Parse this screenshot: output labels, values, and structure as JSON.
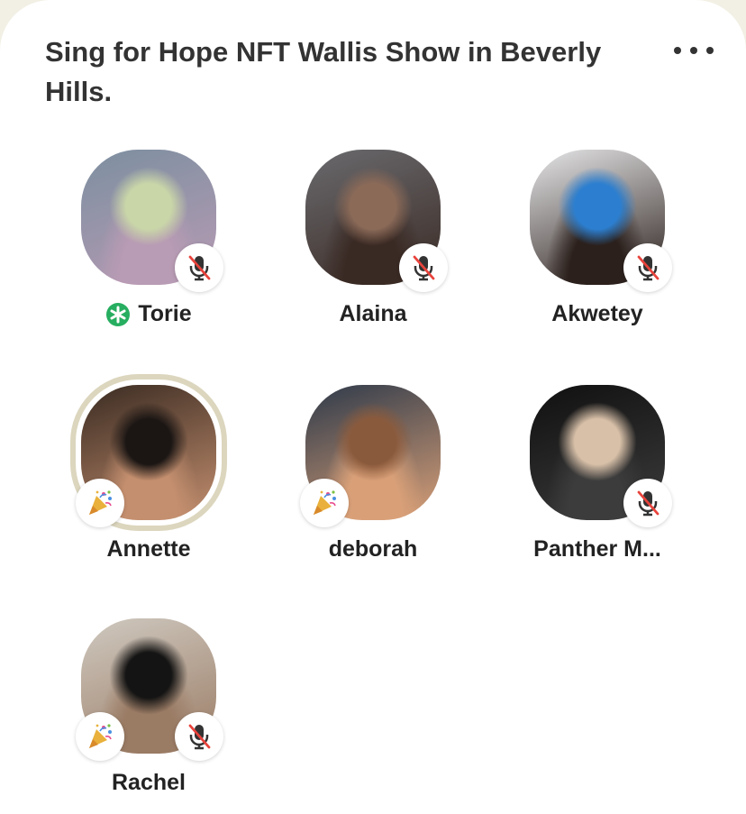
{
  "room": {
    "title": "Sing for Hope NFT Wallis Show in Beverly Hills."
  },
  "speakers": [
    {
      "name": "Torie",
      "moderator": true,
      "muted": true,
      "party": false,
      "speaking": false,
      "colors": [
        "#7c8fa0",
        "#b89bb4",
        "#c9d6a8"
      ]
    },
    {
      "name": "Alaina",
      "moderator": false,
      "muted": true,
      "party": false,
      "speaking": false,
      "colors": [
        "#6a6a6e",
        "#3a2a24",
        "#8b6a58"
      ]
    },
    {
      "name": "Akwetey",
      "moderator": false,
      "muted": true,
      "party": false,
      "speaking": false,
      "colors": [
        "#e6e6e8",
        "#2b201c",
        "#2c7fd0"
      ]
    },
    {
      "name": "Annette",
      "moderator": false,
      "muted": false,
      "party": true,
      "speaking": true,
      "colors": [
        "#3a2b22",
        "#c48f6f",
        "#1b1614"
      ]
    },
    {
      "name": "deborah",
      "moderator": false,
      "muted": false,
      "party": true,
      "speaking": false,
      "colors": [
        "#2e3a4a",
        "#d9a078",
        "#8a5a3c"
      ]
    },
    {
      "name": "Panther M...",
      "moderator": false,
      "muted": true,
      "party": false,
      "speaking": false,
      "colors": [
        "#101010",
        "#3c3c3c",
        "#d8c0a8"
      ]
    },
    {
      "name": "Rachel",
      "moderator": false,
      "muted": true,
      "party": true,
      "speaking": false,
      "colors": [
        "#cfc9c0",
        "#9a7b64",
        "#141414"
      ]
    }
  ],
  "icons": {
    "more": "more-horizontal-icon",
    "moderator": "green-asterisk-icon",
    "mute": "mic-off-icon",
    "party": "party-popper-icon"
  },
  "accent": "#27ae60"
}
